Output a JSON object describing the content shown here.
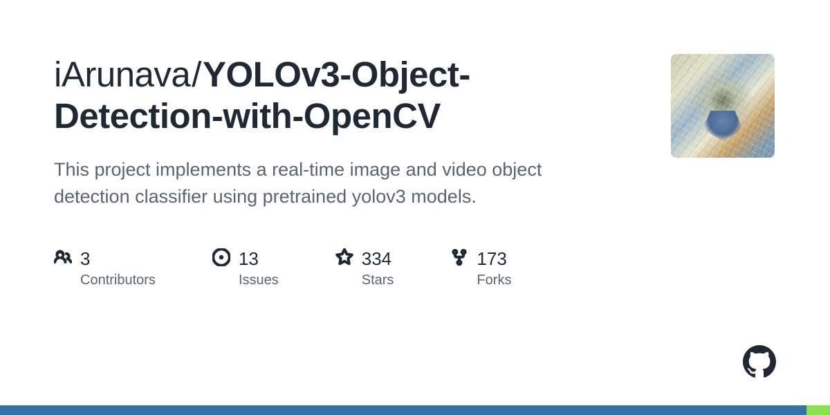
{
  "repo": {
    "owner": "iArunava",
    "name": "YOLOv3-Object-Detection-with-OpenCV",
    "description": "This project implements a real-time image and video object detection classifier using pretrained yolov3 models."
  },
  "stats": {
    "contributors": {
      "count": "3",
      "label": "Contributors"
    },
    "issues": {
      "count": "13",
      "label": "Issues"
    },
    "stars": {
      "count": "334",
      "label": "Stars"
    },
    "forks": {
      "count": "173",
      "label": "Forks"
    }
  },
  "lang_bar": [
    {
      "color": "#3572A5",
      "percent": 97.2
    },
    {
      "color": "#89e051",
      "percent": 2.8
    }
  ]
}
